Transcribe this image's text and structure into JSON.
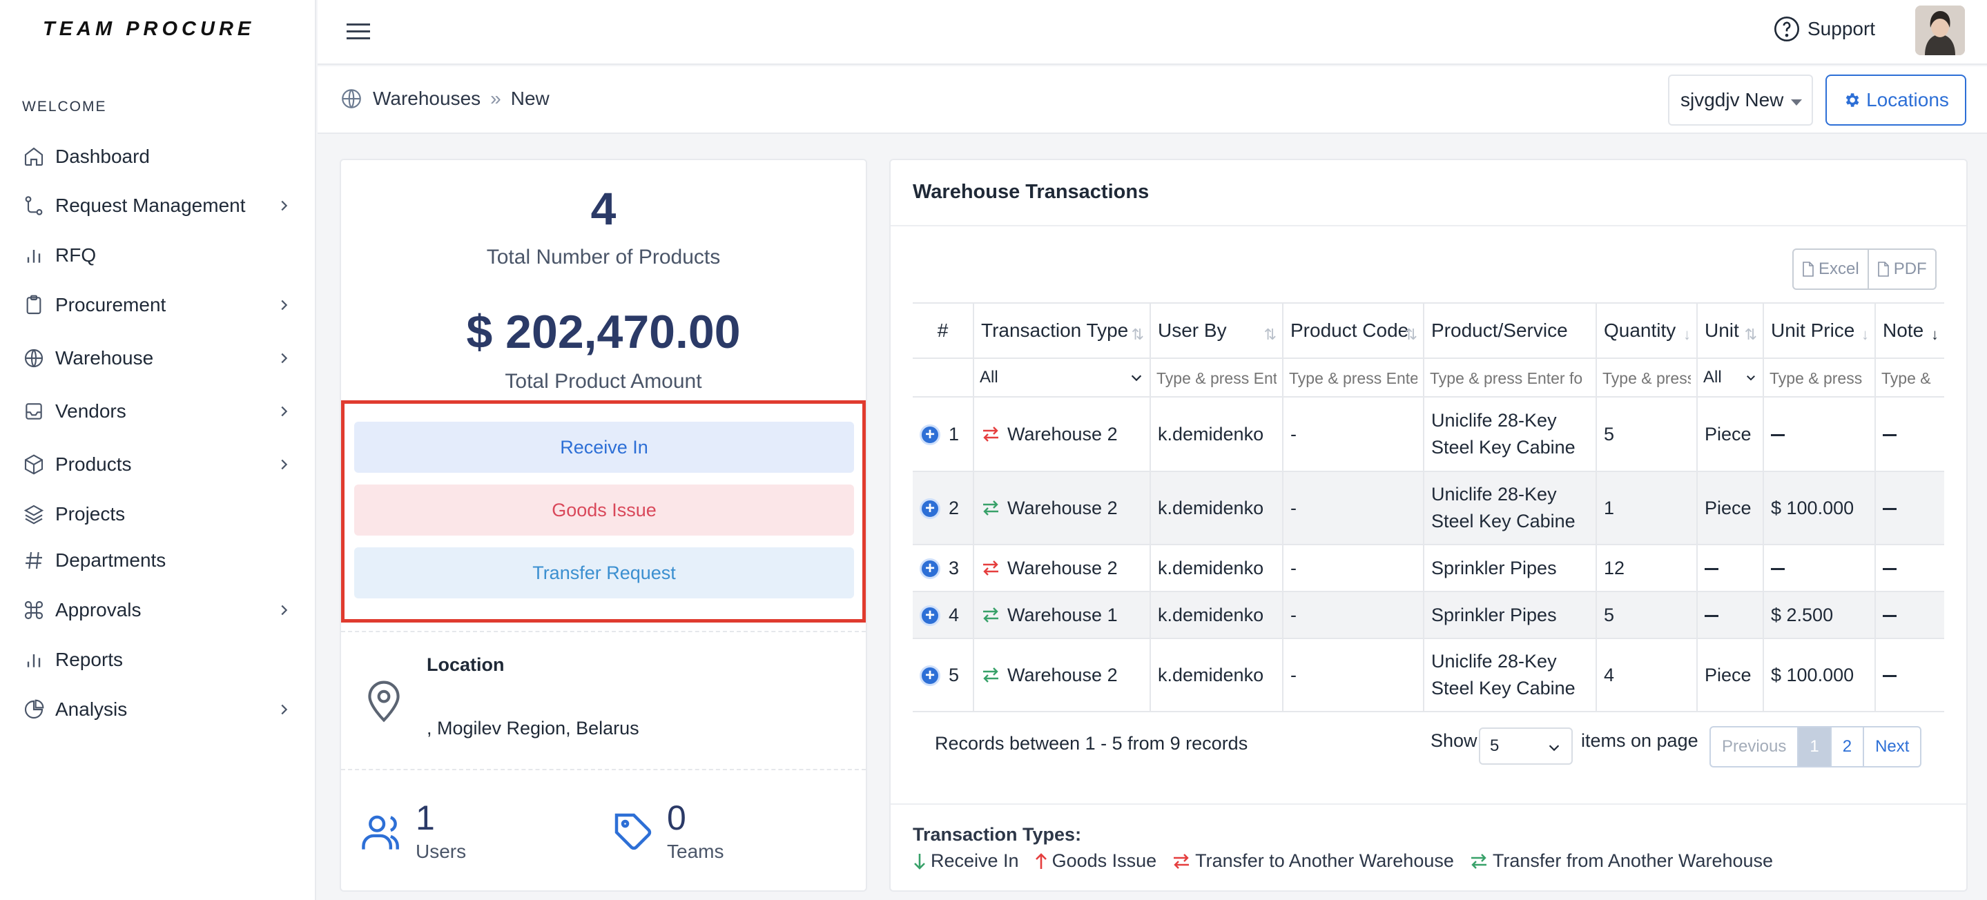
{
  "brand": "TEAM PROCURE",
  "sidebar": {
    "section_label": "WELCOME",
    "items": [
      {
        "label": "Dashboard",
        "icon": "home-icon",
        "has_children": false
      },
      {
        "label": "Request Management",
        "icon": "flow-icon",
        "has_children": true
      },
      {
        "label": "RFQ",
        "icon": "bar-chart-icon",
        "has_children": false
      },
      {
        "label": "Procurement",
        "icon": "clipboard-icon",
        "has_children": true
      },
      {
        "label": "Warehouse",
        "icon": "globe-icon",
        "has_children": true
      },
      {
        "label": "Vendors",
        "icon": "inbox-icon",
        "has_children": true
      },
      {
        "label": "Products",
        "icon": "box-icon",
        "has_children": true
      },
      {
        "label": "Projects",
        "icon": "layers-icon",
        "has_children": false
      },
      {
        "label": "Departments",
        "icon": "hash-icon",
        "has_children": false
      },
      {
        "label": "Approvals",
        "icon": "command-icon",
        "has_children": true
      },
      {
        "label": "Reports",
        "icon": "bar-chart-icon",
        "has_children": false
      },
      {
        "label": "Analysis",
        "icon": "pie-chart-icon",
        "has_children": true
      }
    ]
  },
  "topbar": {
    "support_label": "Support"
  },
  "breadcrumb": {
    "root": "Warehouses",
    "separator": "»",
    "current": "New"
  },
  "warehouse_select": {
    "value": "sjvgdjv New"
  },
  "locations_button": "Locations",
  "summary": {
    "total_products": "4",
    "total_products_label": "Total Number of Products",
    "total_amount": "$ 202,470.00",
    "total_amount_label": "Total Product Amount",
    "actions": {
      "receive_in": "Receive In",
      "goods_issue": "Goods Issue",
      "transfer_request": "Transfer Request"
    },
    "location_title": "Location",
    "location_value": ", Mogilev Region, Belarus",
    "users_count": "1",
    "users_label": "Users",
    "teams_count": "0",
    "teams_label": "Teams"
  },
  "transactions": {
    "title": "Warehouse Transactions",
    "export": {
      "excel": "Excel",
      "pdf": "PDF"
    },
    "columns": [
      "#",
      "Transaction Type",
      "User By",
      "Product Code",
      "Product/Service",
      "Quantity",
      "Unit",
      "Unit Price",
      "Note"
    ],
    "filters": {
      "type_value": "All",
      "user_placeholder": "Type & press Enter",
      "code_placeholder": "Type & press Enter",
      "product_placeholder": "Type & press Enter fo",
      "qty_placeholder": "Type & press",
      "unit_value": "All",
      "price_placeholder": "Type & press",
      "note_placeholder": "Type &"
    },
    "rows": [
      {
        "num": "1",
        "dir": "to",
        "type": "Warehouse 2",
        "user": "k.demidenko",
        "code": "-",
        "product": "Uniclife 28-Key Steel Key Cabine",
        "qty": "5",
        "unit": "Piece",
        "price": "",
        "note": ""
      },
      {
        "num": "2",
        "dir": "from",
        "type": "Warehouse 2",
        "user": "k.demidenko",
        "code": "-",
        "product": "Uniclife 28-Key Steel Key Cabine",
        "qty": "1",
        "unit": "Piece",
        "price": "$ 100.000",
        "note": ""
      },
      {
        "num": "3",
        "dir": "to",
        "type": "Warehouse 2",
        "user": "k.demidenko",
        "code": "-",
        "product": "Sprinkler Pipes",
        "qty": "12",
        "unit": "",
        "price": "",
        "note": ""
      },
      {
        "num": "4",
        "dir": "from",
        "type": "Warehouse 1",
        "user": "k.demidenko",
        "code": "-",
        "product": "Sprinkler Pipes",
        "qty": "5",
        "unit": "",
        "price": "$ 2.500",
        "note": ""
      },
      {
        "num": "5",
        "dir": "from",
        "type": "Warehouse 2",
        "user": "k.demidenko",
        "code": "-",
        "product": "Uniclife 28-Key Steel Key Cabine",
        "qty": "4",
        "unit": "Piece",
        "price": "$ 100.000",
        "note": ""
      }
    ],
    "records_text": "Records between 1 - 5 from 9 records",
    "show_label": "Show",
    "page_size": "5",
    "items_label": "items on page",
    "pagination": [
      "Previous",
      "1",
      "2",
      "Next"
    ],
    "legend_title": "Transaction Types:",
    "legend": [
      {
        "label": "Receive In",
        "color": "#38a169"
      },
      {
        "label": "Goods Issue",
        "color": "#e53e3e"
      },
      {
        "label": "Transfer to Another Warehouse",
        "color": "#e53e3e"
      },
      {
        "label": "Transfer from Another Warehouse",
        "color": "#38a169"
      }
    ]
  },
  "colors": {
    "accent": "#2d6fd6",
    "receive_bg": "#e4ecfb",
    "issue_bg": "#fbe6e8",
    "transfer_bg": "#e6f0fa",
    "highlight_border": "#e03b2f"
  }
}
